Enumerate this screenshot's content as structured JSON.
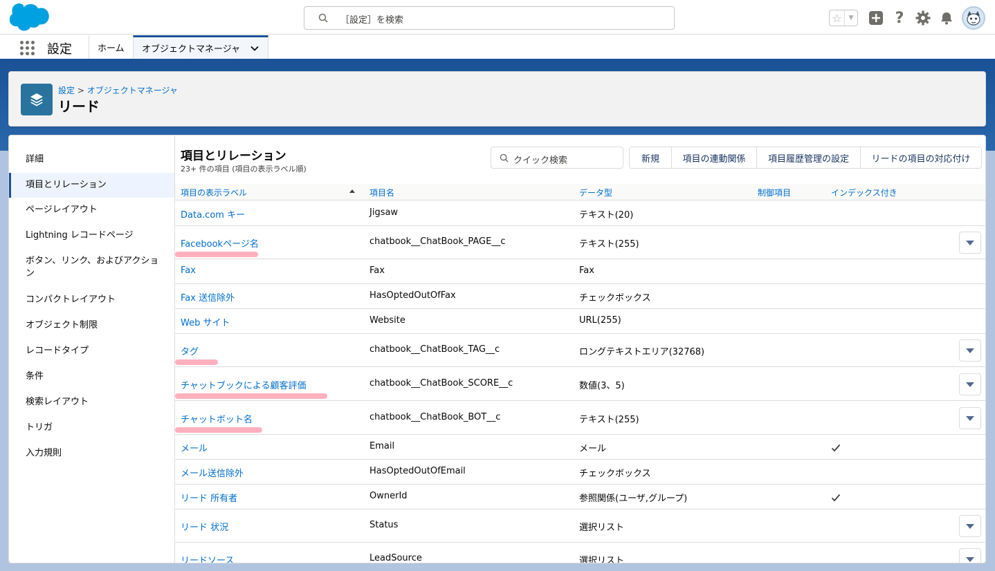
{
  "header": {
    "search_placeholder": "［設定］を検索",
    "help_label": "?"
  },
  "context": {
    "app_name": "設定",
    "tabs": [
      {
        "label": "ホーム"
      },
      {
        "label": "オブジェクトマネージャ"
      }
    ]
  },
  "page_header": {
    "breadcrumb_root": "設定",
    "breadcrumb_sep": ">",
    "breadcrumb_leaf": "オブジェクトマネージャ",
    "title": "リード"
  },
  "sidebar": {
    "items": [
      {
        "label": "詳細"
      },
      {
        "label": "項目とリレーション"
      },
      {
        "label": "ページレイアウト"
      },
      {
        "label": "Lightning レコードページ"
      },
      {
        "label": "ボタン、リンク、およびアクション"
      },
      {
        "label": "コンパクトレイアウト"
      },
      {
        "label": "オブジェクト制限"
      },
      {
        "label": "レコードタイプ"
      },
      {
        "label": "条件"
      },
      {
        "label": "検索レイアウト"
      },
      {
        "label": "トリガ"
      },
      {
        "label": "入力規則"
      }
    ]
  },
  "section": {
    "title": "項目とリレーション",
    "subtitle": "23+ 件の項目 (項目の表示ラベル順)",
    "quick_search_placeholder": "クイック検索",
    "buttons": [
      {
        "label": "新規"
      },
      {
        "label": "項目の連動関係"
      },
      {
        "label": "項目履歴管理の設定"
      },
      {
        "label": "リードの項目の対応付け"
      }
    ]
  },
  "table": {
    "columns": [
      "項目の表示ラベル",
      "項目名",
      "データ型",
      "制御項目",
      "インデックス付き"
    ],
    "rows": [
      {
        "label": "Data.com キー",
        "api": "Jigsaw",
        "type": "テキスト(20)",
        "indexed": false,
        "menu": false,
        "highlight": false
      },
      {
        "label": "Facebookページ名",
        "api": "chatbook__ChatBook_PAGE__c",
        "type": "テキスト(255)",
        "indexed": false,
        "menu": true,
        "highlight": true
      },
      {
        "label": "Fax",
        "api": "Fax",
        "type": "Fax",
        "indexed": false,
        "menu": false,
        "highlight": false
      },
      {
        "label": "Fax 送信除外",
        "api": "HasOptedOutOfFax",
        "type": "チェックボックス",
        "indexed": false,
        "menu": false,
        "highlight": false
      },
      {
        "label": "Web サイト",
        "api": "Website",
        "type": "URL(255)",
        "indexed": false,
        "menu": false,
        "highlight": false
      },
      {
        "label": "タグ",
        "api": "chatbook__ChatBook_TAG__c",
        "type": "ロングテキストエリア(32768)",
        "indexed": false,
        "menu": true,
        "highlight": true
      },
      {
        "label": "チャットブックによる顧客評価",
        "api": "chatbook__ChatBook_SCORE__c",
        "type": "数値(3、5)",
        "indexed": false,
        "menu": true,
        "highlight": true
      },
      {
        "label": "チャットボット名",
        "api": "chatbook__ChatBook_BOT__c",
        "type": "テキスト(255)",
        "indexed": false,
        "menu": true,
        "highlight": true
      },
      {
        "label": "メール",
        "api": "Email",
        "type": "メール",
        "indexed": true,
        "menu": false,
        "highlight": false
      },
      {
        "label": "メール送信除外",
        "api": "HasOptedOutOfEmail",
        "type": "チェックボックス",
        "indexed": false,
        "menu": false,
        "highlight": false
      },
      {
        "label": "リード 所有者",
        "api": "OwnerId",
        "type": "参照関係(ユーザ,グループ)",
        "indexed": true,
        "menu": false,
        "highlight": false
      },
      {
        "label": "リード 状況",
        "api": "Status",
        "type": "選択リスト",
        "indexed": false,
        "menu": true,
        "highlight": false
      },
      {
        "label": "リードソース",
        "api": "LeadSource",
        "type": "選択リスト",
        "indexed": false,
        "menu": true,
        "highlight": false
      }
    ]
  },
  "colors": {
    "brand": "#1b5297",
    "link": "#006dcc",
    "highlight": "#ff96aa",
    "object_icon": "#2a739e"
  }
}
